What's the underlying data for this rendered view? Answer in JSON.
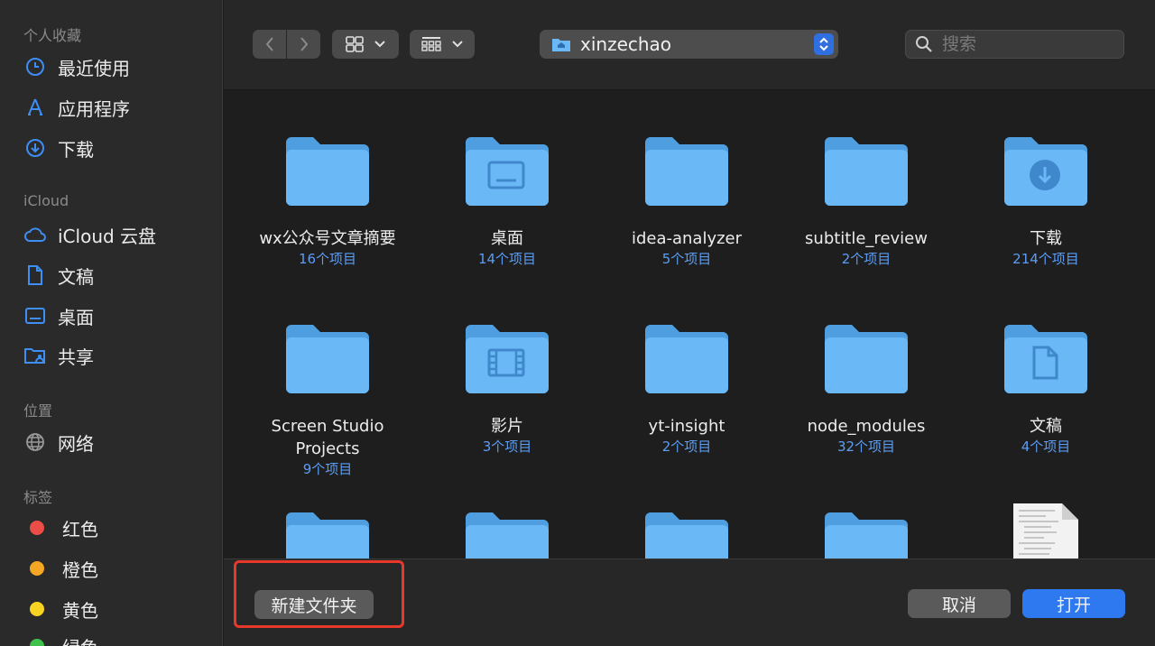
{
  "sidebar": {
    "sections": [
      {
        "title": "个人收藏",
        "items": [
          {
            "label": "最近使用",
            "icon": "clock-icon"
          },
          {
            "label": "应用程序",
            "icon": "applications-icon"
          },
          {
            "label": "下载",
            "icon": "download-icon"
          }
        ]
      },
      {
        "title": "iCloud",
        "items": [
          {
            "label": "iCloud 云盘",
            "icon": "cloud-icon"
          },
          {
            "label": "文稿",
            "icon": "document-icon"
          },
          {
            "label": "桌面",
            "icon": "desktop-icon"
          },
          {
            "label": "共享",
            "icon": "shared-folder-icon"
          }
        ]
      },
      {
        "title": "位置",
        "items": [
          {
            "label": "网络",
            "icon": "globe-icon"
          }
        ]
      },
      {
        "title": "标签",
        "items": [
          {
            "label": "红色",
            "color": "#ec4d47"
          },
          {
            "label": "橙色",
            "color": "#f5a623"
          },
          {
            "label": "黄色",
            "color": "#f8d321"
          },
          {
            "label": "绿色",
            "color": "#3fc14b"
          }
        ]
      }
    ]
  },
  "toolbar": {
    "path": "xinzechao",
    "search_placeholder": "搜索"
  },
  "items": [
    {
      "name": "wx公众号文章摘要",
      "count": "16个项目",
      "glyph": "none"
    },
    {
      "name": "桌面",
      "count": "14个项目",
      "glyph": "desktop"
    },
    {
      "name": "idea-analyzer",
      "count": "5个项目",
      "glyph": "none"
    },
    {
      "name": "subtitle_review",
      "count": "2个项目",
      "glyph": "none"
    },
    {
      "name": "下载",
      "count": "214个项目",
      "glyph": "download"
    },
    {
      "name": "Screen Studio Projects",
      "count": "9个项目",
      "glyph": "none"
    },
    {
      "name": "影片",
      "count": "3个项目",
      "glyph": "film"
    },
    {
      "name": "yt-insight",
      "count": "2个项目",
      "glyph": "none"
    },
    {
      "name": "node_modules",
      "count": "32个项目",
      "glyph": "none"
    },
    {
      "name": "文稿",
      "count": "4个项目",
      "glyph": "document"
    }
  ],
  "buttons": {
    "new_folder": "新建文件夹",
    "cancel": "取消",
    "open": "打开"
  },
  "colors": {
    "accent": "#2f79f0",
    "folder": "#6ab8f5",
    "highlight": "#e8372b"
  }
}
